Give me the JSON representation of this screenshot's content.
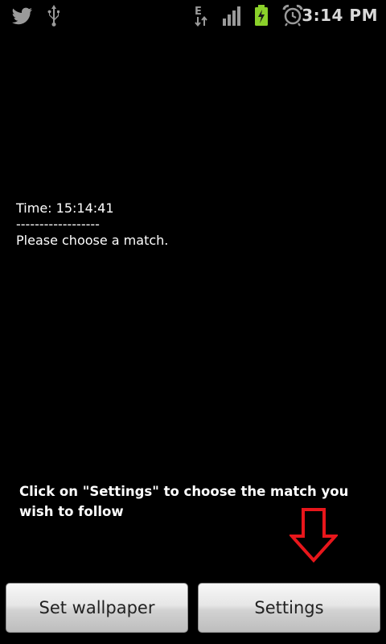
{
  "status_bar": {
    "time": "3:14 PM",
    "icons": [
      "twitter-icon",
      "usb-icon",
      "edge-data-icon",
      "signal-icon",
      "battery-charging-icon",
      "alarm-icon"
    ],
    "network_label": "E",
    "colors": {
      "icon": "#9a9a9a",
      "battery": "#8bd12a",
      "time": "#d8d8d8"
    }
  },
  "content": {
    "time_line": "Time: 15:14:41",
    "separator": "------------------",
    "message": "Please choose a match.",
    "hint": "Click on \"Settings\" to choose the match you wish to follow",
    "arrow_icon": "down-arrow-icon",
    "arrow_color": "#e8161b"
  },
  "buttons": {
    "set_wallpaper": "Set wallpaper",
    "settings": "Settings"
  }
}
